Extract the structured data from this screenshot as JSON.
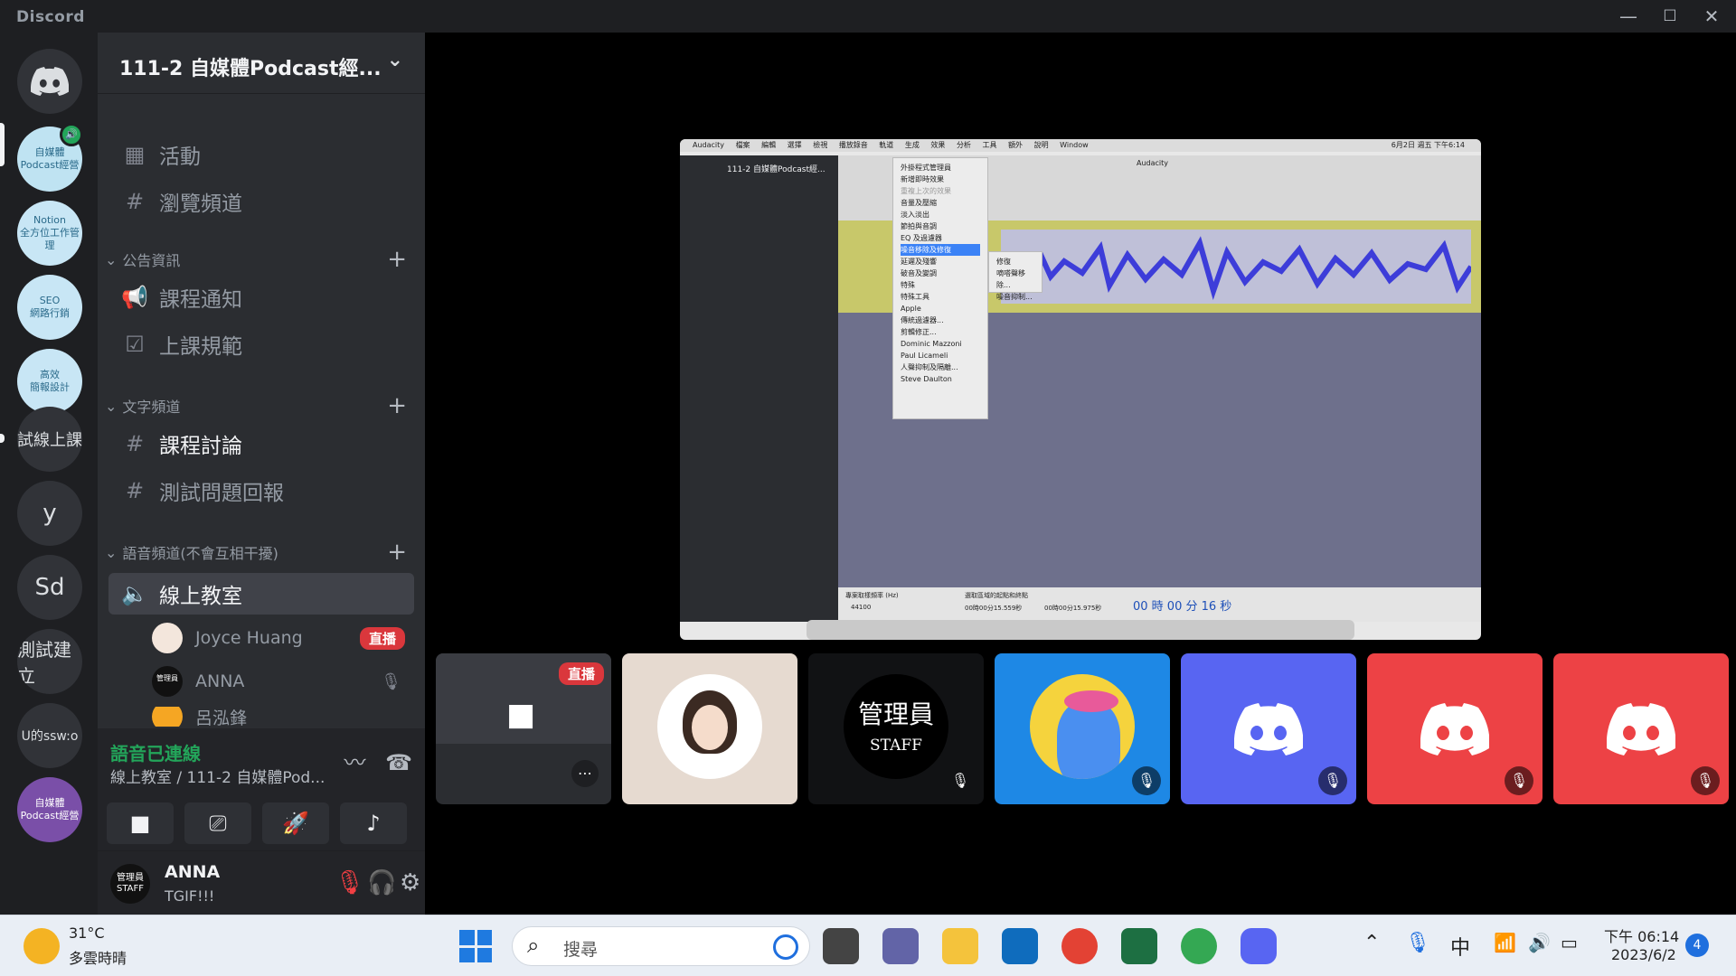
{
  "window": {
    "brand": "Discord",
    "minimize": "—",
    "maximize": "☐",
    "close": "✕"
  },
  "rail": {
    "servers": [
      {
        "label": "自媒體\nPodcast經營"
      },
      {
        "label": "Notion\n全方位工作管理"
      },
      {
        "label": "SEO\n網路行銷"
      },
      {
        "label": "高效\n簡報設計"
      },
      {
        "label": "試線上課"
      },
      {
        "label": "y"
      },
      {
        "label": "Sd"
      },
      {
        "label": "測試建立"
      },
      {
        "label": "U的ssw:o"
      },
      {
        "label": "自媒體\nPodcast經營"
      }
    ]
  },
  "sidebar": {
    "guild_name": "111-2 自媒體Podcast經...",
    "top_items": [
      {
        "label": "活動",
        "icon": "calendar-icon"
      },
      {
        "label": "瀏覽頻道",
        "icon": "browse-channels-icon"
      }
    ],
    "categories": [
      {
        "label": "公告資訊",
        "items": [
          "課程通知",
          "上課規範"
        ]
      },
      {
        "label": "文字頻道",
        "items": [
          "課程討論",
          "測試問題回報"
        ]
      },
      {
        "label": "語音頻道(不會互相干擾)",
        "items": [
          "線上教室"
        ]
      }
    ],
    "voice_users": [
      {
        "name": "Joyce Huang",
        "badge": "直播"
      },
      {
        "name": "ANNA",
        "badge": ""
      },
      {
        "name": "呂泓鋒",
        "badge": ""
      }
    ],
    "voice_panel": {
      "status": "語音已連線",
      "location": "線上教室 / 111-2 自媒體Pod..."
    },
    "user": {
      "name": "ANNA",
      "status": "TGIF!!!",
      "avatar_text": "管理員\nSTAFF"
    }
  },
  "stage": {
    "screenshare": {
      "menubar": [
        "Audacity",
        "檔案",
        "編輯",
        "選擇",
        "檢視",
        "播放錄音",
        "軌道",
        "生成",
        "效果",
        "分析",
        "工具",
        "額外",
        "說明",
        "Window"
      ],
      "clock": "6月2日 週五 下午6:14",
      "app_title": "Audacity",
      "inner_discord_title": "111-2 自媒體Podcast經...",
      "effect_menu": [
        "外掛程式管理員",
        "新增即時效果",
        "重複上次的效果",
        "音量及壓縮",
        "淡入淡出",
        "節拍與音調",
        "EQ 及過濾器",
        "噪音移除及修復",
        "延遲及殘響",
        "破音及變調",
        "特殊",
        "特殊工具",
        "Apple",
        "傳統過濾器...",
        "剪輯修正...",
        "Dominic Mazzoni",
        "Paul Licameli",
        "人聲抑制及隔離...",
        "Steve Daulton"
      ],
      "submenu": [
        "修復",
        "嘀嗒聲移除...",
        "噪音抑制..."
      ],
      "sample_rate_label": "專案取樣頻率 (Hz)",
      "sample_rate": "44100",
      "selection_label": "選取區域的起點和終點",
      "time_start": "00時00分15.559秒",
      "time_end": "00時00分15.975秒",
      "time_display": "00 時 00 分 16 秒"
    },
    "tiles": [
      {
        "kind": "stream",
        "badge": "直播",
        "color": "#2b2d31"
      },
      {
        "kind": "avatar",
        "color": "#e6dad0"
      },
      {
        "kind": "staff",
        "text": "管理員\nSTAFF",
        "color": "#111214"
      },
      {
        "kind": "character",
        "color": "#1e88e5"
      },
      {
        "kind": "discord",
        "color": "#5865f2"
      },
      {
        "kind": "discord",
        "color": "#ed4245"
      },
      {
        "kind": "discord",
        "color": "#ed4245"
      }
    ]
  },
  "taskbar": {
    "weather_temp": "31°C",
    "weather_desc": "多雲時晴",
    "search_placeholder": "搜尋",
    "input_method": "中",
    "clock_time": "下午 06:14",
    "clock_date": "2023/6/2",
    "notifications": "4"
  }
}
